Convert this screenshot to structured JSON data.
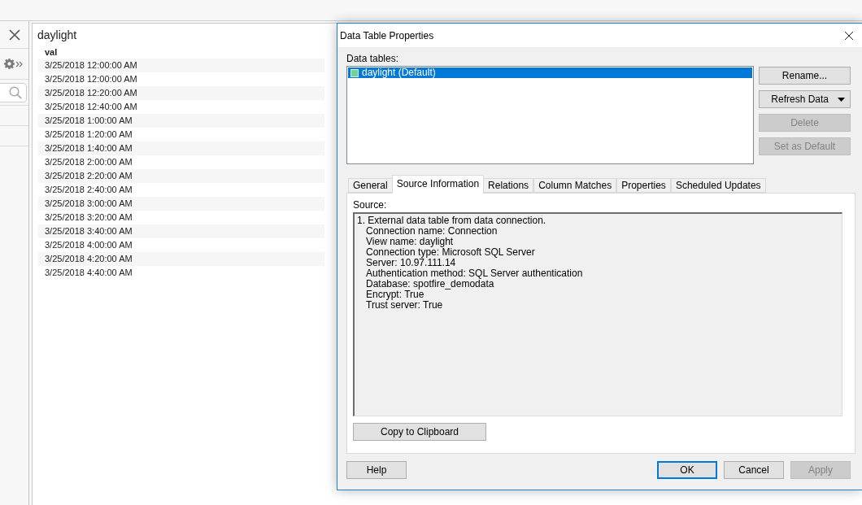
{
  "table_view": {
    "title": "daylight",
    "columns": [
      "val"
    ],
    "rows": [
      [
        "3/25/2018 12:00:00 AM"
      ],
      [
        "3/25/2018 12:00:00 AM"
      ],
      [
        "3/25/2018 12:20:00 AM"
      ],
      [
        "3/25/2018 12:40:00 AM"
      ],
      [
        "3/25/2018 1:00:00 AM"
      ],
      [
        "3/25/2018 1:20:00 AM"
      ],
      [
        "3/25/2018 1:40:00 AM"
      ],
      [
        "3/25/2018 2:00:00 AM"
      ],
      [
        "3/25/2018 2:20:00 AM"
      ],
      [
        "3/25/2018 2:40:00 AM"
      ],
      [
        "3/25/2018 3:00:00 AM"
      ],
      [
        "3/25/2018 3:20:00 AM"
      ],
      [
        "3/25/2018 3:40:00 AM"
      ],
      [
        "3/25/2018 4:00:00 AM"
      ],
      [
        "3/25/2018 4:20:00 AM"
      ],
      [
        "3/25/2018 4:40:00 AM"
      ]
    ]
  },
  "dialog": {
    "title": "Data Table Properties",
    "data_tables": {
      "label": "Data tables:",
      "items": [
        {
          "label": "daylight (Default)",
          "selected": true
        }
      ]
    },
    "side_buttons": [
      {
        "label": "Rename...",
        "kind": "plain",
        "disabled": false
      },
      {
        "label": "Refresh Data",
        "kind": "dropdown",
        "disabled": false
      },
      {
        "label": "Delete",
        "kind": "plain",
        "disabled": true
      },
      {
        "label": "Set as Default",
        "kind": "plain",
        "disabled": true
      }
    ],
    "tabs": [
      {
        "label": "General",
        "selected": false
      },
      {
        "label": "Source Information",
        "selected": true
      },
      {
        "label": "Relations",
        "selected": false
      },
      {
        "label": "Column Matches",
        "selected": false
      },
      {
        "label": "Properties",
        "selected": false
      },
      {
        "label": "Scheduled Updates",
        "selected": false
      }
    ],
    "source_panel": {
      "label": "Source:",
      "entries": [
        {
          "title": "1. External data table from data connection.",
          "details": [
            "Connection name: Connection",
            "View name: daylight",
            "Connection type: Microsoft SQL Server",
            "Server: 10.97.111.14",
            "Authentication method: SQL Server authentication",
            "Database: spotfire_demodata",
            "Encrypt: True",
            "Trust server: True"
          ]
        }
      ],
      "copy_button": "Copy to Clipboard"
    },
    "footer": {
      "left_buttons": [
        {
          "label": "Help",
          "disabled": false,
          "focused": false
        }
      ],
      "right_buttons": [
        {
          "label": "OK",
          "disabled": false,
          "focused": true
        },
        {
          "label": "Cancel",
          "disabled": false,
          "focused": false
        },
        {
          "label": "Apply",
          "disabled": true,
          "focused": false
        }
      ]
    }
  }
}
